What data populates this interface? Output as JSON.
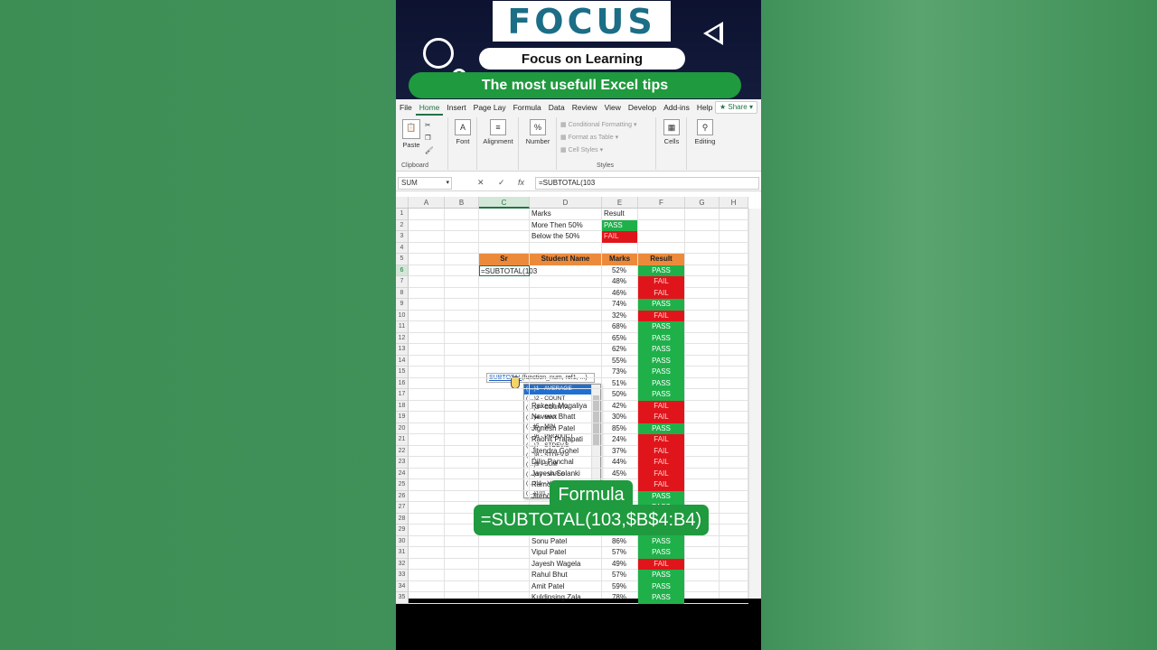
{
  "branding": {
    "logo": "FOCUS",
    "tagline": "Focus on Learning",
    "subtitle": "The most usefull Excel tips"
  },
  "ribbon_tabs": [
    "File",
    "Home",
    "Insert",
    "Page Lay",
    "Formula",
    "Data",
    "Review",
    "View",
    "Develop",
    "Add-ins",
    "Help"
  ],
  "share_label": "Share",
  "ribbon": {
    "paste": "Paste",
    "clipboard": "Clipboard",
    "font": "Font",
    "alignment": "Alignment",
    "number": "Number",
    "conditional": "Conditional Formatting",
    "format_table": "Format as Table",
    "cell_styles": "Cell Styles",
    "styles": "Styles",
    "cells": "Cells",
    "editing": "Editing"
  },
  "formula_bar": {
    "name_box": "SUM",
    "formula": "=SUBTOTAL(103"
  },
  "columns": [
    "A",
    "B",
    "C",
    "D",
    "E",
    "F",
    "G",
    "H"
  ],
  "rows": [
    "1",
    "2",
    "3",
    "4",
    "5",
    "6",
    "7",
    "8",
    "9",
    "10",
    "11",
    "12",
    "13",
    "14",
    "15",
    "16",
    "17",
    "18",
    "19",
    "20",
    "21",
    "22",
    "23",
    "24",
    "25",
    "26",
    "27",
    "28",
    "29",
    "30",
    "31",
    "32",
    "33",
    "34",
    "35"
  ],
  "legend": {
    "marks_h": "Marks",
    "result_h": "Result",
    "more_label": "More Then 50%",
    "more_result": "PASS",
    "below_label": "Below the 50%",
    "below_result": "FAIL"
  },
  "table_headers": {
    "sr": "Sr",
    "name": "Student Name",
    "marks": "Marks",
    "result": "Result"
  },
  "active_cell": "=SUBTOTAL(103",
  "tooltip": {
    "fn": "SUBTOTAL",
    "args": "(function_num, ref1, ...)"
  },
  "dropdown_items": [
    "1 - AVERAGE",
    "2 - COUNT",
    "3 - COUNTA",
    "4 - MAX",
    "5 - MIN",
    "6 - PRODUCT",
    "7 - STDEV.S",
    "8 - STDEV.P",
    "9 - SUM",
    "10 - VAR.S",
    "11 - VAR.P",
    "101 - AVERAGE"
  ],
  "students": [
    {
      "name": "",
      "marks": "52%",
      "result": "PASS"
    },
    {
      "name": "",
      "marks": "48%",
      "result": "FAIL"
    },
    {
      "name": "",
      "marks": "46%",
      "result": "FAIL"
    },
    {
      "name": "",
      "marks": "74%",
      "result": "PASS"
    },
    {
      "name": "",
      "marks": "32%",
      "result": "FAIL"
    },
    {
      "name": "",
      "marks": "68%",
      "result": "PASS"
    },
    {
      "name": "",
      "marks": "65%",
      "result": "PASS"
    },
    {
      "name": "",
      "marks": "62%",
      "result": "PASS"
    },
    {
      "name": "",
      "marks": "55%",
      "result": "PASS"
    },
    {
      "name": "",
      "marks": "73%",
      "result": "PASS"
    },
    {
      "name": "",
      "marks": "51%",
      "result": "PASS"
    },
    {
      "name": "",
      "marks": "50%",
      "result": "PASS"
    },
    {
      "name": "Rakesh Mogaliya",
      "marks": "42%",
      "result": "FAIL"
    },
    {
      "name": "Naveen Bhatt",
      "marks": "30%",
      "result": "FAIL"
    },
    {
      "name": "Jignesh Patel",
      "marks": "85%",
      "result": "PASS"
    },
    {
      "name": "Raohit Prajapati",
      "marks": "24%",
      "result": "FAIL"
    },
    {
      "name": "Jitendra Gohel",
      "marks": "37%",
      "result": "FAIL"
    },
    {
      "name": "Dilip Panchal",
      "marks": "44%",
      "result": "FAIL"
    },
    {
      "name": "Jayesh Solanki",
      "marks": "45%",
      "result": "FAIL"
    },
    {
      "name": "Ramc",
      "marks": "",
      "result": "FAIL"
    },
    {
      "name": "Jitend",
      "marks": "",
      "result": "PASS"
    },
    {
      "name": "",
      "marks": "",
      "result": "PASS"
    },
    {
      "name": "",
      "marks": "",
      "result": "PASS"
    },
    {
      "name": "",
      "marks": "",
      "result": "PASS"
    },
    {
      "name": "Sonu Patel",
      "marks": "86%",
      "result": "PASS"
    },
    {
      "name": "Vipul Patel",
      "marks": "57%",
      "result": "PASS"
    },
    {
      "name": "Jayesh Wagela",
      "marks": "49%",
      "result": "FAIL"
    },
    {
      "name": "Rahul Bhut",
      "marks": "57%",
      "result": "PASS"
    },
    {
      "name": "Amit Patel",
      "marks": "59%",
      "result": "PASS"
    },
    {
      "name": "Kuldipsing Zala",
      "marks": "78%",
      "result": "PASS"
    }
  ],
  "callout": {
    "title": "Formula",
    "formula": "=SUBTOTAL(103,$B$4:B4)"
  },
  "colors": {
    "pass": "#1fb04a",
    "fail": "#e0151b",
    "header": "#ec8a3c",
    "accent": "#217346"
  }
}
